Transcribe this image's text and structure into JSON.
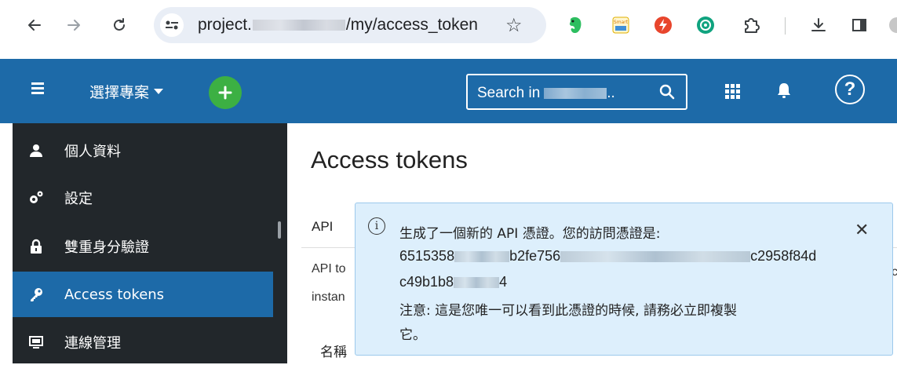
{
  "browser": {
    "url_prefix": "project.",
    "url_suffix": "/my/access_token"
  },
  "header": {
    "project_select_label": "選擇專案",
    "search_placeholder": "Search in",
    "search_suffix": "..",
    "help_label": "?",
    "brand_color": "#1d6aa8"
  },
  "sidebar": {
    "items": [
      {
        "label": "個人資料",
        "icon": "user-icon",
        "active": false
      },
      {
        "label": "設定",
        "icon": "gears-icon",
        "active": false
      },
      {
        "label": "雙重身分驗證",
        "icon": "lock-icon",
        "active": false
      },
      {
        "label": "Access tokens",
        "icon": "key-icon",
        "active": true
      },
      {
        "label": "連線管理",
        "icon": "monitor-icon",
        "active": false
      }
    ]
  },
  "main": {
    "title": "Access tokens",
    "tab_api": "API",
    "desc_line1": "API to",
    "desc_line2": "instan",
    "right_edge_char": "c",
    "column_name": "名稱"
  },
  "notice": {
    "line1": "生成了一個新的 API 憑證。您的訪問憑證是:",
    "token_part1": "6515358",
    "token_part2": "b2fe756",
    "token_part3": "c2958f84d",
    "token_part4": "c49b1b8",
    "token_part5": "4",
    "line3": "注意: 這是您唯一可以看到此憑證的時候, 請務必立即複製",
    "line4": "它。",
    "close_label": "✕",
    "info_glyph": "i",
    "background_color": "#ddeffc"
  }
}
